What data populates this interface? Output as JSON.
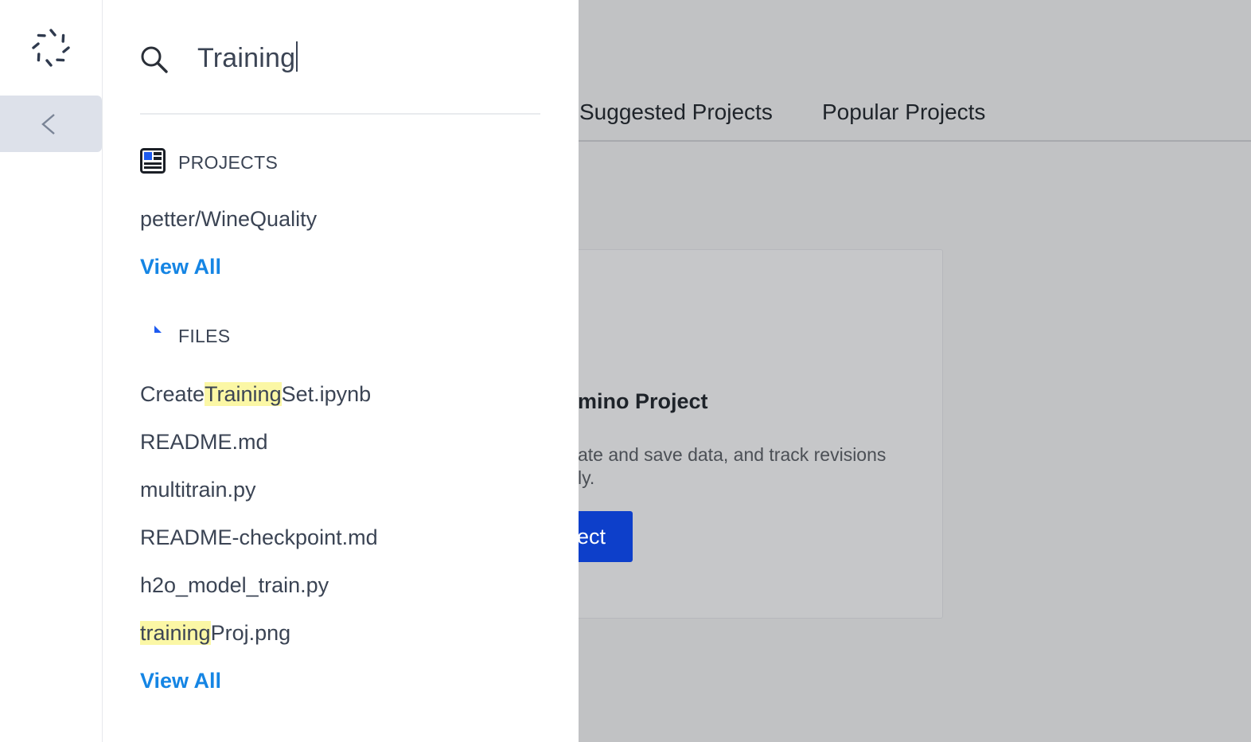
{
  "search": {
    "query": "Training"
  },
  "projects": {
    "header": "PROJECTS",
    "items": [
      "petter/WineQuality"
    ],
    "view_all": "View All"
  },
  "files": {
    "header": "FILES",
    "items": [
      {
        "before": "Create",
        "match": "Training",
        "after": "Set.ipynb"
      },
      {
        "before": "README.md",
        "match": "",
        "after": ""
      },
      {
        "before": "multitrain.py",
        "match": "",
        "after": ""
      },
      {
        "before": "README-checkpoint.md",
        "match": "",
        "after": ""
      },
      {
        "before": "h2o_model_train.py",
        "match": "",
        "after": ""
      },
      {
        "before": "",
        "match": "training",
        "after": "Proj.png"
      }
    ],
    "view_all": "View All"
  },
  "background": {
    "tabs": [
      "Suggested Projects",
      "Popular Projects"
    ],
    "card": {
      "title": "mino Project",
      "description_line1": "ate and save data, and track revisions",
      "description_line2": "ly.",
      "button": "ect"
    }
  },
  "colors": {
    "link": "#1585e4",
    "highlight": "#fbf7a5",
    "primary_button": "#0d3fca",
    "text": "#3b4454"
  },
  "icons": {
    "logo": "domino-logo-icon",
    "collapse": "chevron-left-icon",
    "search": "search-icon",
    "projects": "project-icon",
    "files": "file-icon"
  }
}
